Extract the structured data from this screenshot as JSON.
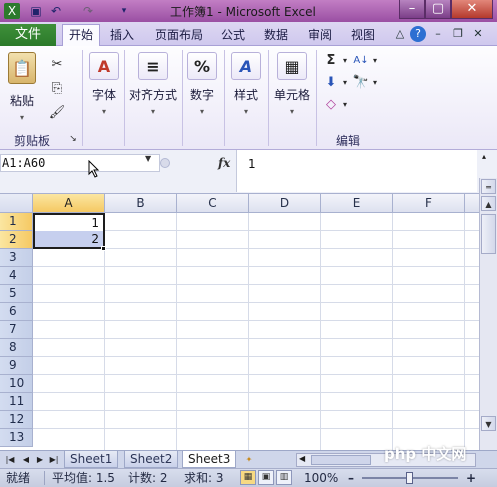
{
  "window": {
    "title": "工作簿1 - Microsoft Excel",
    "qa_icons": [
      "excel-logo-icon",
      "save-icon",
      "undo-icon",
      "redo-icon",
      "customize-icon"
    ],
    "controls": {
      "minimize": "–",
      "maximize": "▢",
      "close": "✕"
    }
  },
  "tabs": {
    "file": "文件",
    "items": [
      "开始",
      "插入",
      "页面布局",
      "公式",
      "数据",
      "审阅",
      "视图"
    ],
    "active_index": 0
  },
  "ribbon": {
    "clipboard": {
      "paste": "粘贴",
      "group": "剪贴板"
    },
    "font": {
      "label": "字体",
      "icon_glyph": "A"
    },
    "alignment": {
      "label": "对齐方式",
      "icon_glyph": "≡"
    },
    "number": {
      "label": "数字",
      "icon_glyph": "%"
    },
    "styles": {
      "label": "样式",
      "icon_glyph": "A"
    },
    "cells": {
      "label": "单元格",
      "icon_glyph": "▦"
    },
    "editing": {
      "group": "编辑",
      "sum_glyph": "Σ",
      "sort_glyph": "A↓"
    }
  },
  "formula_bar": {
    "name_box": "A1:A60",
    "fx": "fx",
    "value": "1"
  },
  "grid": {
    "columns": [
      "A",
      "B",
      "C",
      "D",
      "E",
      "F"
    ],
    "rows": [
      "1",
      "2",
      "3",
      "4",
      "5",
      "6",
      "7",
      "8",
      "9",
      "10",
      "11",
      "12",
      "13"
    ],
    "cells": {
      "A1": "1",
      "A2": "2"
    },
    "selected_column": "A",
    "selected_rows": [
      "1",
      "2"
    ]
  },
  "sheets": {
    "tabs": [
      "Sheet1",
      "Sheet2",
      "Sheet3"
    ],
    "active_index": 2
  },
  "status": {
    "ready": "就绪",
    "average": "平均值: 1.5",
    "count": "计数: 2",
    "sum": "求和: 3",
    "zoom": "100%"
  },
  "watermark": "php 中文网",
  "colors": {
    "title_bar": "#9a4fa3",
    "file_tab": "#2b7a2a",
    "selection": "#c6cfee",
    "header_highlight": "#f5c963"
  }
}
